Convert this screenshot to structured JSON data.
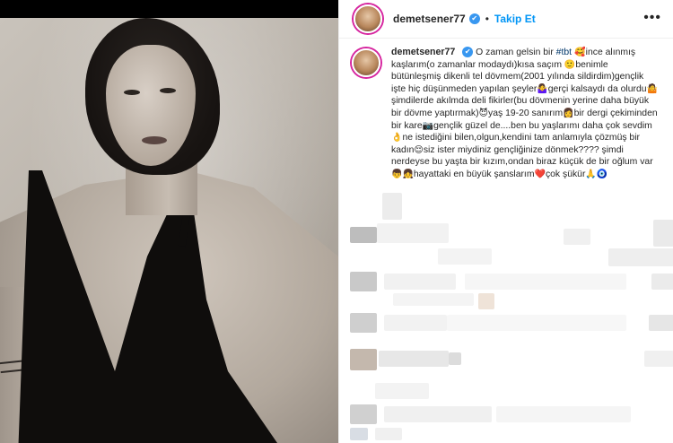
{
  "post": {
    "username": "demetsener77",
    "follow_label": "Takip Et",
    "more_label": "•••",
    "separator": "•",
    "caption_parts": [
      "O zaman gelsin bir ",
      "#tbt",
      " 🥰",
      "ince alınmış kaşlarım(o zamanlar modaydı)kısa saçım ",
      "🙂",
      "benimle bütünleşmiş dikenli tel dövmem(2001 yılında sildirdim)gençlik işte hiç düşünmeden yapılan şeyler",
      "🤷‍♀️",
      "gerçi kalsaydı da olurdu",
      "🤷",
      " şimdilerde akılmda deli fikirler(bu dövmenin yerine daha büyük bir dövme yaptırmak)",
      "😈",
      "yaş 19-20 sanırım",
      "👩",
      "bir dergi çekiminden bir kare",
      "📷",
      "gençlik güzel de....ben bu yaşlarımı daha çok sevdim",
      "👌",
      "ne istediğini bilen,olgun,kendini tam anlamıyla çözmüş bir kadın",
      "😌",
      "siz ister miydiniz gençliğinize dönmek????",
      " şimdi nerdeyse bu yaşta bir kızım,ondan biraz küçük de bir oğlum var",
      "👦👧",
      "hayattaki en büyük şanslarım",
      "❤️",
      "çok şükür",
      "🙏🧿"
    ]
  },
  "icons": {
    "verified": "✔",
    "verified_name": "verified-badge-icon"
  },
  "colors": {
    "link": "#0095f6",
    "verified": "#3897f0",
    "text": "#262626",
    "border": "#efefef"
  }
}
